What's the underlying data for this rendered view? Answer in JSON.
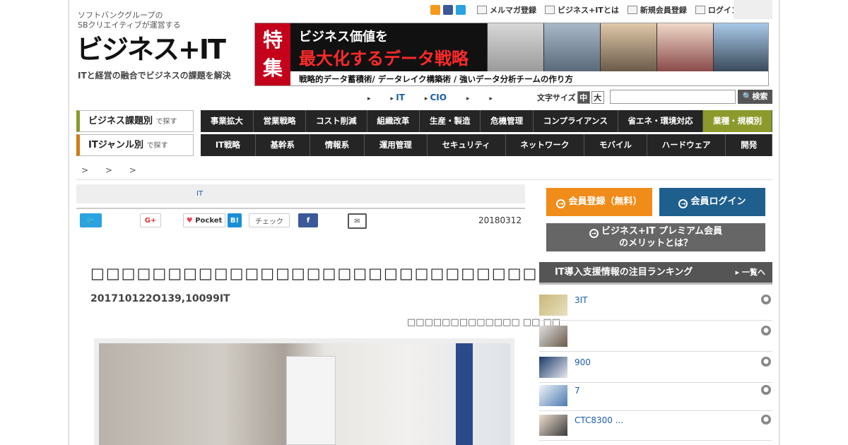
{
  "header": {
    "logo_sub_line1": "ソフトバンクグループの",
    "logo_sub_line2": "SBクリエイティブが運営する",
    "logo_main": "ビジネス+IT",
    "logo_tagline": "ITと経営の融合でビジネスの課題を解決",
    "top_links": [
      "メルマガ登録",
      "ビジネス+ITとは",
      "新規会員登録",
      "ログイン"
    ]
  },
  "banner": {
    "badge": "特集",
    "line1": "ビジネス価値を",
    "line2": "最大化するデータ戦略",
    "line3": "戦略的データ蓄積術/ データレイク構築術 / 強いデータ分析チームの作り方"
  },
  "utility": {
    "links": [
      "",
      "IT",
      "CIO",
      "",
      ""
    ],
    "font_size_label": "文字サイズ",
    "font_size_options": [
      "中",
      "大"
    ],
    "search_button": "検索"
  },
  "nav": {
    "topic_label": "ビジネス課題別",
    "topic_suffix": "で探す",
    "topic_items": [
      "事業拡大",
      "営業戦略",
      "コスト削減",
      "組織改革",
      "生産・製造",
      "危機管理",
      "コンプライアンス",
      "省エネ・環境対応",
      "業種・規模別"
    ],
    "genre_label": "ITジャンル別",
    "genre_suffix": "で探す",
    "genre_items": [
      "IT戦略",
      "基幹系",
      "情報系",
      "運用管理",
      "セキュリティ",
      "ネットワーク",
      "モバイル",
      "ハードウェア",
      "開発"
    ]
  },
  "breadcrumb": "> > >",
  "article": {
    "category": "IT",
    "date": "20180312",
    "title": "□□□□□□□□□□□□□□□□□□□□□□□□□□□□□□□□□",
    "subtitle": "201710122O139,10099IT",
    "byline": "□□□□□□□□□□□□□ □□ □□"
  },
  "share": {
    "pocket": "Pocket",
    "hatena": "B!",
    "check": "チェック"
  },
  "sidebar": {
    "register": "会員登録（無料）",
    "login": "会員ログイン",
    "premium_line1": "ビジネス+IT プレミアム会員",
    "premium_line2": "のメリットとは？",
    "ranking_title": "IT導入支援情報の注目ランキング",
    "ranking_more": "一覧へ",
    "ranking": [
      {
        "text": "3IT"
      },
      {
        "text": ""
      },
      {
        "text": "900"
      },
      {
        "text": "7"
      },
      {
        "text": "CTC8300 ..."
      }
    ]
  },
  "colors": {
    "nav_bg": "#252525",
    "accent_green": "#8b9a2b",
    "accent_orange": "#f08c1a",
    "login_blue": "#1f5f8e",
    "banner_red": "#c4001a"
  }
}
